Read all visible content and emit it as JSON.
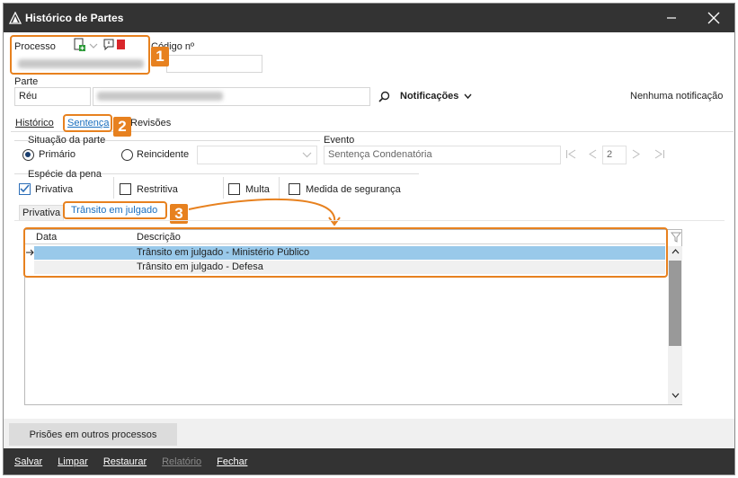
{
  "window": {
    "title": "Histórico de Partes"
  },
  "processo": {
    "label": "Processo",
    "codigo_label": "Código nº"
  },
  "parte": {
    "label": "Parte",
    "type_value": "Réu",
    "notifications_label": "Notificações",
    "notifications_status": "Nenhuma notificação"
  },
  "tabs": [
    "Histórico",
    "Sentença",
    "Revisões"
  ],
  "situacao": {
    "label": "Situação da parte",
    "primario": "Primário",
    "reincidente": "Reincidente"
  },
  "evento": {
    "label": "Evento",
    "value": "Sentença Condenatória",
    "page": "2"
  },
  "especie": {
    "label": "Espécie da pena",
    "privativa": "Privativa",
    "restritiva": "Restritiva",
    "multa": "Multa",
    "medida": "Medida de segurança"
  },
  "subtabs": [
    "Privativa",
    "Trânsito em julgado"
  ],
  "grid": {
    "col_data": "Data",
    "col_descricao": "Descrição",
    "rows": [
      "Trânsito em julgado - Ministério Público",
      "Trânsito em julgado - Defesa"
    ]
  },
  "badges": [
    "1",
    "2",
    "3"
  ],
  "prisoes_button": "Prisões em outros processos",
  "footer": [
    "Salvar",
    "Limpar",
    "Restaurar",
    "Relatório",
    "Fechar"
  ],
  "colors": {
    "accent": "#e7811f",
    "titlebar": "#333333",
    "selected_row": "#99c9ea"
  }
}
